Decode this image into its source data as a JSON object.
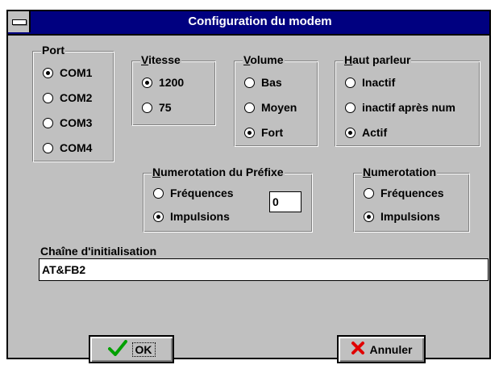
{
  "window": {
    "title": "Configuration du modem"
  },
  "port": {
    "legend": "Port",
    "options": [
      "COM1",
      "COM2",
      "COM3",
      "COM4"
    ],
    "selected": "COM1"
  },
  "vitesse": {
    "legend_hotkey": "V",
    "legend_rest": "itesse",
    "options": [
      "1200",
      "75"
    ],
    "selected": "1200"
  },
  "volume": {
    "legend_hotkey": "V",
    "legend_rest": "olume",
    "options": [
      "Bas",
      "Moyen",
      "Fort"
    ],
    "selected": "Fort"
  },
  "haut_parleur": {
    "legend_hotkey": "H",
    "legend_rest": "aut parleur",
    "options": [
      "Inactif",
      "inactif après num",
      "Actif"
    ],
    "selected": "Actif"
  },
  "numerotation_prefixe": {
    "legend_hotkey": "N",
    "legend_rest": "umerotation du Préfixe",
    "options": [
      "Fréquences",
      "Impulsions"
    ],
    "selected": "Impulsions",
    "prefix_value": "0"
  },
  "numerotation": {
    "legend_hotkey": "N",
    "legend_rest": "umerotation",
    "options": [
      "Fréquences",
      "Impulsions"
    ],
    "selected": "Impulsions"
  },
  "init_string": {
    "label": "Chaîne d'initialisation",
    "value": "AT&FB2"
  },
  "buttons": {
    "ok": "OK",
    "cancel": "Annuler"
  },
  "icons": {
    "ok": "check-icon",
    "cancel": "x-icon",
    "ok_color": "#00a000",
    "cancel_color": "#e00000"
  }
}
